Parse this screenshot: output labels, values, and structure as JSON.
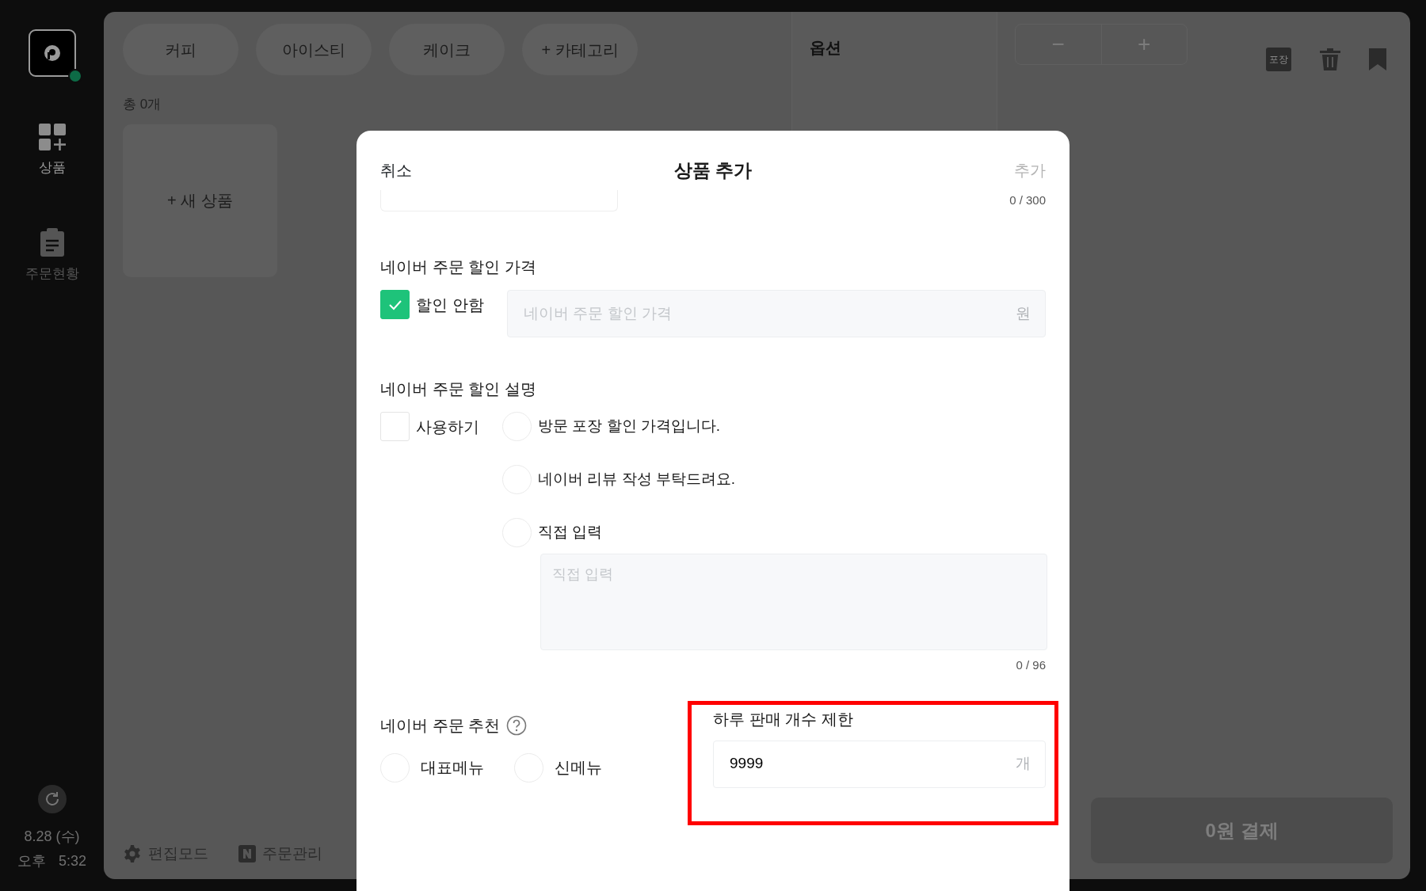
{
  "sidebar": {
    "items": [
      {
        "label": "상품",
        "kind": "products",
        "selected": true
      },
      {
        "label": "주문현황",
        "kind": "orders",
        "selected": false
      }
    ],
    "date": "8.28 (수)",
    "time_period": "오후",
    "time": "5:32"
  },
  "categories": [
    "커피",
    "아이스티",
    "케이크",
    "+ 카테고리"
  ],
  "product_count": "총 0개",
  "new_product_card": "+ 새 상품",
  "options_panel": {
    "title": "옵션"
  },
  "stepper": {
    "minus": "−",
    "plus": "+"
  },
  "takeout_badge": "포장",
  "footer": {
    "edit_mode": "편집모드",
    "order_management": "주문관리"
  },
  "pay_button": "0원 결제",
  "modal": {
    "cancel": "취소",
    "title": "상품 추가",
    "confirm": "추가",
    "confirm_disabled": true,
    "description_counter": "0 / 300",
    "discount_price": {
      "heading": "네이버 주문 할인 가격",
      "checkbox_label": "할인 안함",
      "checked": true,
      "placeholder": "네이버 주문 할인 가격",
      "unit": "원"
    },
    "discount_description": {
      "heading": "네이버 주문 할인 설명",
      "checkbox_label": "사용하기",
      "checked": false,
      "options": [
        {
          "label": "방문 포장 할인 가격입니다.",
          "selected": false
        },
        {
          "label": "네이버 리뷰 작성 부탁드려요.",
          "selected": false
        },
        {
          "label": "직접 입력",
          "selected": false
        }
      ],
      "textarea_placeholder": "직접 입력",
      "counter": "0 / 96"
    },
    "recommendation": {
      "heading": "네이버 주문 추천",
      "options": [
        {
          "label": "대표메뉴",
          "selected": false
        },
        {
          "label": "신메뉴",
          "selected": false
        }
      ]
    },
    "daily_limit": {
      "heading": "하루 판매 개수 제한",
      "value": "9999",
      "unit": "개",
      "highlighted": true
    }
  }
}
